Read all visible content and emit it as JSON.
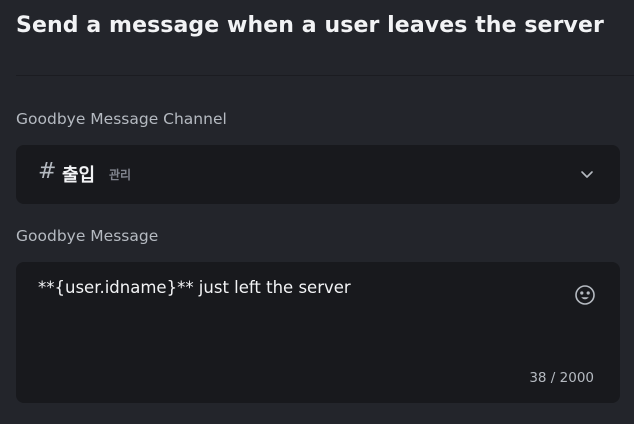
{
  "page": {
    "title": "Send a message when a user leaves the server"
  },
  "channel_field": {
    "label": "Goodbye Message Channel",
    "selected": {
      "prefix_icon": "hash-icon",
      "prefix_glyph": "#",
      "name": "출입",
      "category": "관리"
    },
    "dropdown_icon": "chevron-down-icon"
  },
  "message_field": {
    "label": "Goodbye Message",
    "value": "**{user.idname}** just left the server",
    "emoji_icon": "smiley-icon",
    "char_count": "38 / 2000"
  },
  "colors": {
    "background": "#23252b",
    "input_background": "#18191d",
    "primary_text": "#f2f3f5",
    "secondary_text": "#b5bac1",
    "muted_text": "#80848e"
  }
}
